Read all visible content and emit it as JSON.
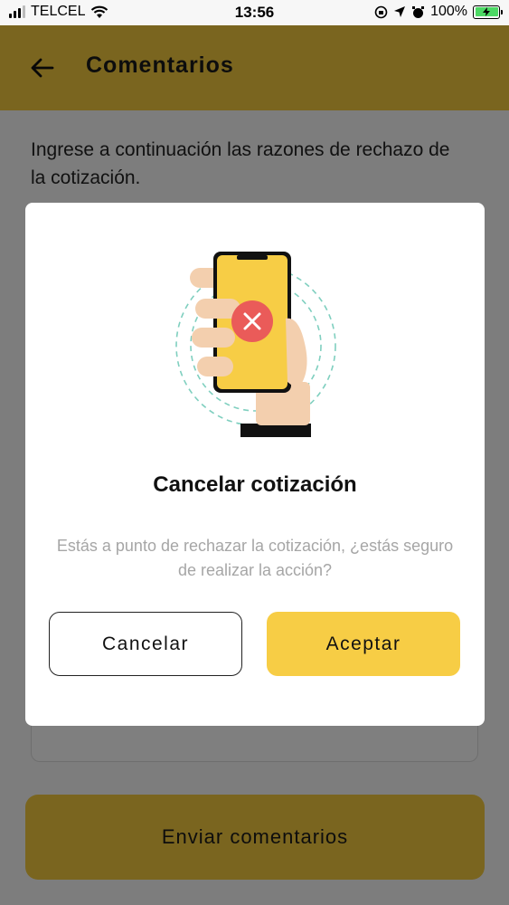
{
  "status_bar": {
    "carrier": "TELCEL",
    "time": "13:56",
    "battery_percent": "100%",
    "icons": [
      "signal-icon",
      "wifi-icon",
      "orientation-lock-icon",
      "location-icon",
      "alarm-icon",
      "battery-charging-icon"
    ]
  },
  "app_bar": {
    "title": "Comentarios",
    "back_icon": "arrow-left-icon",
    "background_color": "#f5ca3e"
  },
  "page": {
    "instructions": "Ingrese a continuación las razones de rechazo de la cotización.",
    "comments_input": {
      "value": "",
      "placeholder": ""
    },
    "send_button_label": "Enviar comentarios"
  },
  "modal": {
    "illustration": "hand-holding-phone-with-cancel-x-icon",
    "title": "Cancelar cotización",
    "message": "Estás a punto de rechazar la cotización, ¿estás seguro de realizar la acción?",
    "cancel_label": "Cancelar",
    "accept_label": "Aceptar",
    "accent_color": "#f7cd45"
  }
}
